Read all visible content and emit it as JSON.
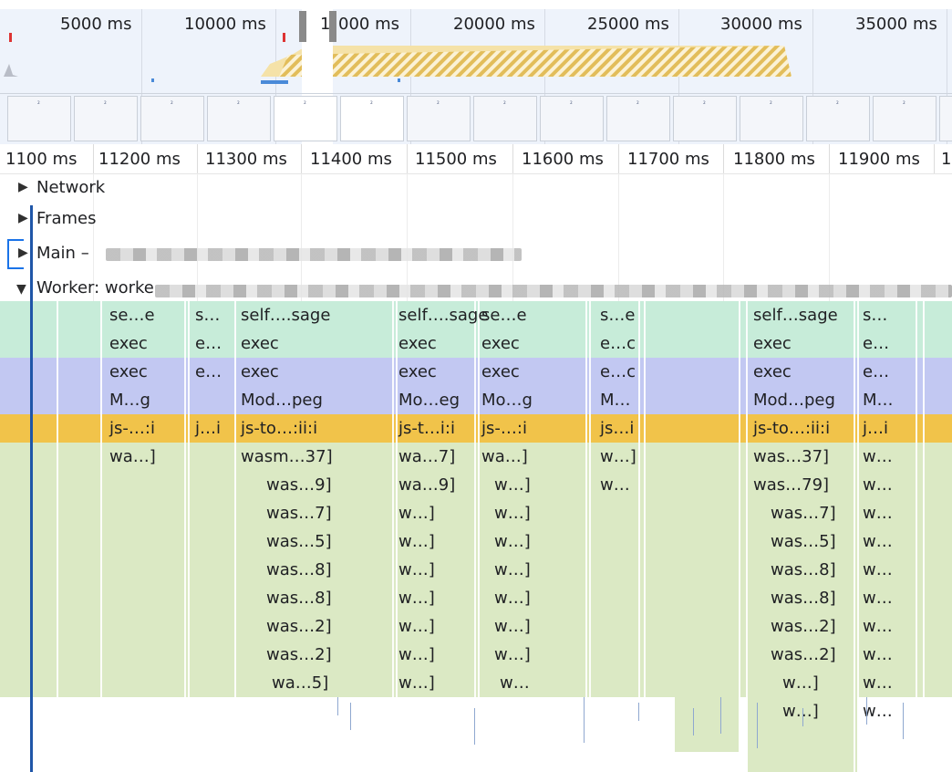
{
  "overview": {
    "ticks": [
      "5000 ms",
      "10000 ms",
      "1",
      "000 ms",
      "20000 ms",
      "25000 ms",
      "30000 ms",
      "35000 ms"
    ]
  },
  "ruler": {
    "ticks": [
      "1100 ms",
      "11200 ms",
      "11300 ms",
      "11400 ms",
      "11500 ms",
      "11600 ms",
      "11700 ms",
      "11800 ms",
      "11900 ms",
      "1"
    ]
  },
  "tracks": {
    "network": "Network",
    "frames": "Frames",
    "main": "Main –",
    "worker": "Worker: worke"
  },
  "colors": {
    "teal": "#c7ecd9",
    "violet": "#c2c8f2",
    "orange": "#f1c34a",
    "green": "#dbe9c4",
    "cursor": "#1f56a8"
  },
  "flame": {
    "rows": [
      [
        "se…e",
        "s…",
        "self….sage",
        "self….sage",
        "se…e",
        "s…e",
        "self…sage",
        "s…"
      ],
      [
        "exec",
        "e…",
        "exec",
        "exec",
        "exec",
        "e…c",
        "exec",
        "e…"
      ],
      [
        "exec",
        "e…",
        "exec",
        "exec",
        "exec",
        "e…c",
        "exec",
        "e…"
      ],
      [
        "M…g",
        "Mod…peg",
        "Mo…eg",
        "Mo…g",
        "M…",
        "Mod…peg",
        "M…"
      ],
      [
        "js-…:i",
        "j…i",
        "js-to…:ii:i",
        "js-t…i:i",
        "js-…:i",
        "js…i",
        "js-to…:ii:i",
        "j…i"
      ],
      [
        "wa…]",
        "wasm…37]",
        "wa…7]",
        "wa…]",
        "w…]",
        "was…37]",
        "w…"
      ],
      [
        "was…9]",
        "wa…9]",
        "w…]",
        "w…",
        "was…79]",
        "w…"
      ],
      [
        "was…7]",
        "w…]",
        "w…]",
        "was…7]",
        "w…"
      ],
      [
        "was…5]",
        "w…]",
        "w…]",
        "was…5]",
        "w…"
      ],
      [
        "was…8]",
        "w…]",
        "w…]",
        "was…8]",
        "w…"
      ],
      [
        "was…8]",
        "w…]",
        "w…]",
        "was…8]",
        "w…"
      ],
      [
        "was…2]",
        "w…]",
        "w…]",
        "was…2]",
        "w…"
      ],
      [
        "was…2]",
        "w…]",
        "w…]",
        "was…2]",
        "w…"
      ],
      [
        "wa…5]",
        "w…]",
        "w…",
        "w…]",
        "w…"
      ],
      [
        "w…]",
        "w…"
      ]
    ]
  }
}
